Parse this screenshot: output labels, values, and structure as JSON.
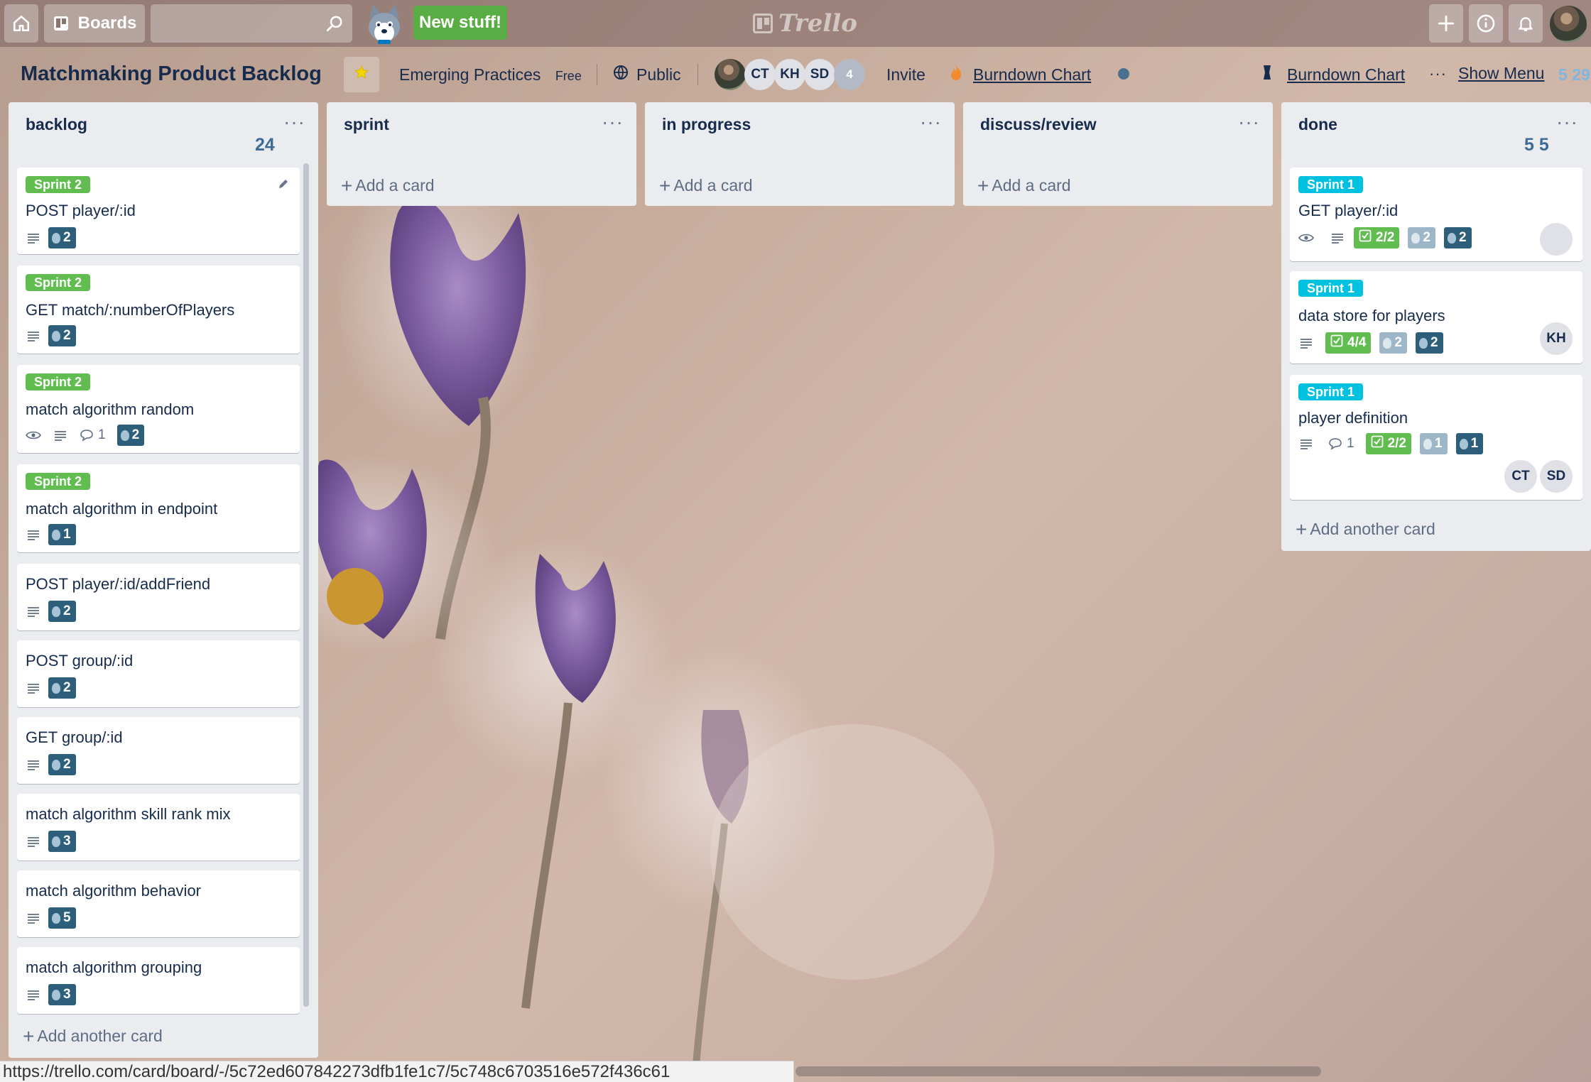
{
  "header": {
    "boards_label": "Boards",
    "search_placeholder": "",
    "new_stuff_label": "New stuff!",
    "logo_text": "Trello"
  },
  "board": {
    "title": "Matchmaking Product Backlog",
    "team_name": "Emerging Practices",
    "team_plan": "Free",
    "visibility": "Public",
    "members": [
      "CT",
      "KH",
      "SD"
    ],
    "members_more": "4",
    "invite_label": "Invite",
    "powerup_left_label": "Burndown Chart",
    "powerup_right_label": "Burndown Chart",
    "show_menu_label": "Show Menu",
    "partial_value": "5 29"
  },
  "lists": {
    "backlog": {
      "title": "backlog",
      "count": "24",
      "add_label": "Add another card",
      "cards": [
        {
          "label": "Sprint 2",
          "title": "POST player/:id",
          "estimate": "2"
        },
        {
          "label": "Sprint 2",
          "title": "GET match/:numberOfPlayers",
          "estimate": "2"
        },
        {
          "label": "Sprint 2",
          "title": "match algorithm random",
          "comments": "1",
          "estimate": "2"
        },
        {
          "label": "Sprint 2",
          "title": "match algorithm in endpoint",
          "estimate": "1"
        },
        {
          "title": "POST player/:id/addFriend",
          "estimate": "2"
        },
        {
          "title": "POST group/:id",
          "estimate": "2"
        },
        {
          "title": "GET group/:id",
          "estimate": "2"
        },
        {
          "title": "match algorithm skill rank mix",
          "estimate": "3"
        },
        {
          "title": "match algorithm behavior",
          "estimate": "5"
        },
        {
          "title": "match algorithm grouping",
          "estimate": "3"
        }
      ]
    },
    "sprint": {
      "title": "sprint",
      "add_label": "Add a card"
    },
    "in_progress": {
      "title": "in progress",
      "add_label": "Add a card"
    },
    "discuss": {
      "title": "discuss/review",
      "add_label": "Add a card"
    },
    "done": {
      "title": "done",
      "count": "5 5",
      "add_label": "Add another card",
      "cards": [
        {
          "label": "Sprint 1",
          "title": "GET player/:id",
          "checklist": "2/2",
          "est_spent": "2",
          "estimate": "2"
        },
        {
          "label": "Sprint 1",
          "title": "data store for players",
          "checklist": "4/4",
          "est_spent": "2",
          "estimate": "2",
          "member": "KH"
        },
        {
          "label": "Sprint 1",
          "title": "player definition",
          "comments": "1",
          "checklist": "2/2",
          "est_spent": "1",
          "estimate": "1",
          "members": [
            "CT",
            "SD"
          ]
        }
      ]
    }
  },
  "status_url": "https://trello.com/card/board/-/5c72ed607842273dfb1fe1c7/5c748c6703516e572f436c61",
  "colors": {
    "label_green": "#61bd4f",
    "label_blue": "#00c2e0",
    "estimate_dark": "#2e5f7a",
    "list_bg": "#ebecf0"
  },
  "icons": [
    "home-icon",
    "boards-icon",
    "search-icon",
    "plus-icon",
    "info-icon",
    "bell-icon",
    "star-icon",
    "globe-icon",
    "fire-icon",
    "description-icon",
    "watch-icon",
    "comment-icon",
    "checklist-icon",
    "estimate-icon",
    "pencil-icon"
  ]
}
